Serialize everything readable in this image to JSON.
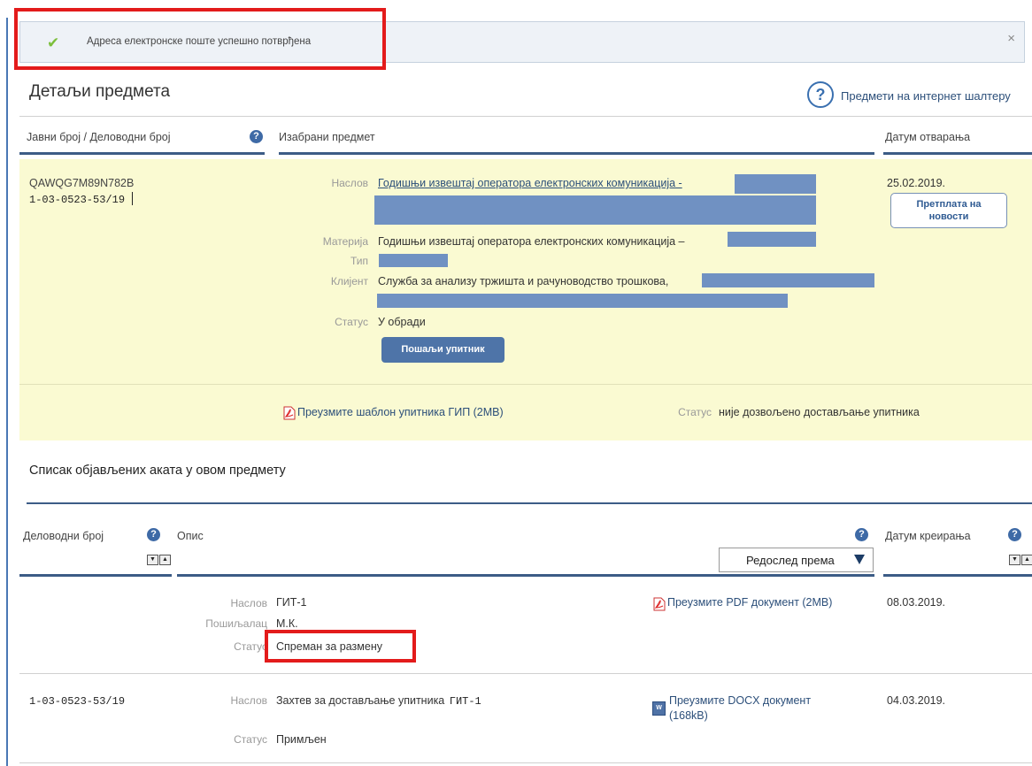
{
  "alert": {
    "message": "Адреса електронске поште успешно потврђена",
    "close": "×"
  },
  "header": {
    "title": "Детаљи предмета",
    "help": "?",
    "link": "Предмети на интернет шалтеру"
  },
  "columns": {
    "col1": "Јавни број / Деловодни број",
    "col2": "Изабрани предмет",
    "col3": "Датум отварања"
  },
  "case": {
    "public_no": "QAWQG7M89N782B",
    "ref_no": "1-03-0523-53/19",
    "date": "25.02.2019.",
    "subscribe_line1": "Претплата на",
    "subscribe_line2": "новости",
    "title_label": "Наслов",
    "title_value": "Годишњи извештај оператора електронских комуникација -",
    "matter_label": "Материја",
    "matter_value": "Годишњи извештај оператора електронских комуникација –",
    "type_label": "Тип",
    "client_label": "Клијент",
    "client_value": "Служба за анализу тржишта и рачуноводство трошкова,",
    "status_label": "Статус",
    "status_value": "У обради",
    "send_button": "Пошаљи упитник",
    "template_link": "Преузмите шаблон упитника ГИП (2MB)",
    "form_status_label": "Статус",
    "form_status_value": "није дозвољено достављање упитника"
  },
  "acts": {
    "title": "Списак објављених аката у овом предмету",
    "col_ref": "Деловодни број",
    "col_desc": "Опис",
    "col_date": "Датум креирања",
    "sort_label": "Редослед према",
    "rows": [
      {
        "ref": "",
        "title_label": "Наслов",
        "title_value": "ГИТ-1",
        "sender_label": "Пошиљалац",
        "sender_value": "М.К.",
        "status_label": "Статус",
        "status_value": "Спреман за размену",
        "link": "Преузмите PDF документ (2MB)",
        "date": "08.03.2019."
      },
      {
        "ref": "1-03-0523-53/19",
        "title_label": "Наслов",
        "title_value": "Захтев за достављање упитника",
        "title_extra": "ГИТ-1",
        "status_label": "Статус",
        "status_value": "Примљен",
        "link_line1": "Преузмите DOCX документ",
        "link_line2": "(168kB)",
        "date": "04.03.2019."
      }
    ]
  },
  "colors": {
    "accent": "#3c5c86",
    "highlight_bg": "#fafad2",
    "redaction": "#7091c2",
    "annotation_red": "#e31b1b"
  }
}
